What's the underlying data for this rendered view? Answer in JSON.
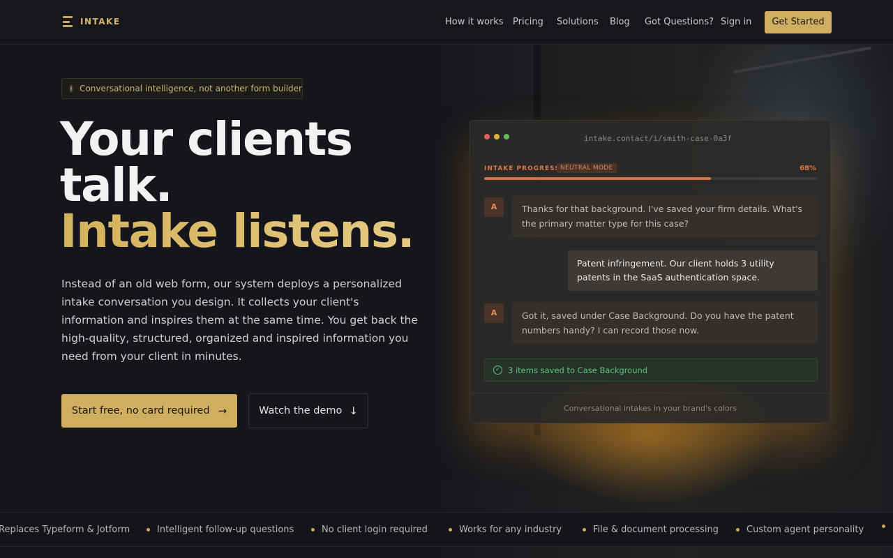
{
  "brand": {
    "name": "INTAKE",
    "accent": "#cfae5f"
  },
  "nav": {
    "links": [
      "How it works",
      "Pricing",
      "Solutions",
      "Blog",
      "Got Questions?",
      "Sign in"
    ],
    "cta": "Get Started"
  },
  "hero": {
    "badge": "Conversational intelligence, not another form builder",
    "title_line1": "Your clients",
    "title_line2": "talk.",
    "title_line3": "Intake listens.",
    "lead": "Instead of an old web form, our system deploys a personalized intake conversation you design. It collects your client's information and inspires them at the same time. You get back the high-quality, structured, organized and inspired information you need from your client in minutes.",
    "primary_button": "Start free, no card required",
    "secondary_button": "Watch the demo"
  },
  "demo": {
    "url": "intake.contact/i/smith-case-0a3f",
    "progress_label": "INTAKE PROGRESS",
    "mode": "NEUTRAL MODE",
    "progress_pct_label": "68%",
    "progress_value": 0.68,
    "messages": [
      {
        "role": "agent",
        "avatar": "A",
        "text": "Thanks for that background. I've saved your firm details. What's the primary matter type for this case?"
      },
      {
        "role": "user",
        "text": "Patent infringement. Our client holds 3 utility patents in the SaaS authentication space."
      },
      {
        "role": "agent",
        "avatar": "A",
        "text": "Got it, saved under Case Background. Do you have the patent numbers handy? I can record those now."
      }
    ],
    "saved_notice": "3 items saved to Case Background",
    "footer": "Conversational intakes in your brand's colors"
  },
  "ticker": [
    "Replaces Typeform & Jotform",
    "Intelligent follow-up questions",
    "No client login required",
    "Works for any industry",
    "File & document processing",
    "Custom agent personality"
  ]
}
